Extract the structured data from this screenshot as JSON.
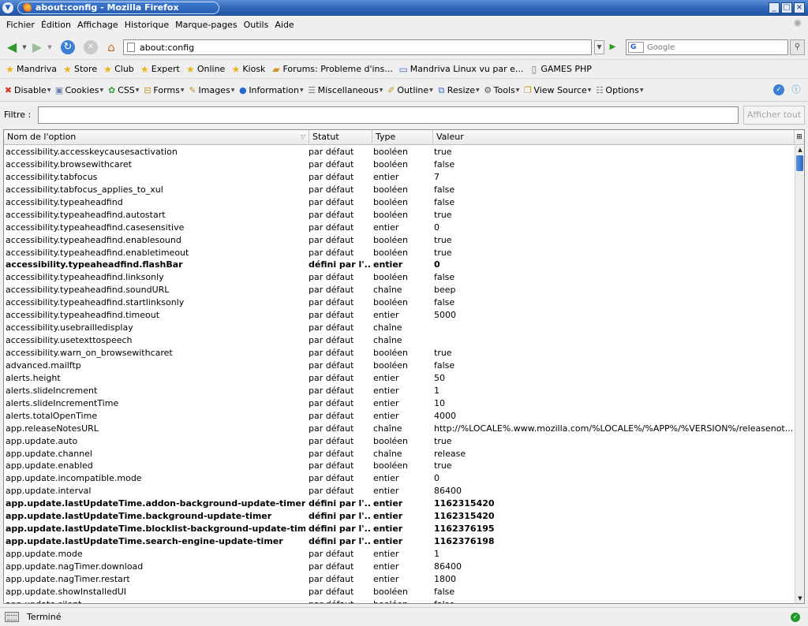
{
  "window": {
    "title": "about:config - Mozilla Firefox"
  },
  "menu": [
    "Fichier",
    "Édition",
    "Affichage",
    "Historique",
    "Marque-pages",
    "Outils",
    "Aide"
  ],
  "navigation": {
    "url": "about:config",
    "search_placeholder": "Google",
    "search_engine": "G"
  },
  "bookmarks": [
    {
      "label": "Mandriva",
      "icon": "star-icon"
    },
    {
      "label": "Store",
      "icon": "star-icon"
    },
    {
      "label": "Club",
      "icon": "star-icon"
    },
    {
      "label": "Expert",
      "icon": "star-icon"
    },
    {
      "label": "Online",
      "icon": "star-icon"
    },
    {
      "label": "Kiosk",
      "icon": "star-icon"
    },
    {
      "label": "Forums: Probleme d'ins...",
      "icon": "folder-icon"
    },
    {
      "label": "Mandriva Linux vu par e...",
      "icon": "screen-icon"
    },
    {
      "label": "GAMES PHP",
      "icon": "page-icon"
    }
  ],
  "developer_toolbar": [
    {
      "label": "Disable",
      "icon": "disable-icon"
    },
    {
      "label": "Cookies",
      "icon": "cookies-icon"
    },
    {
      "label": "CSS",
      "icon": "css-icon"
    },
    {
      "label": "Forms",
      "icon": "forms-icon"
    },
    {
      "label": "Images",
      "icon": "images-icon"
    },
    {
      "label": "Information",
      "icon": "information-icon"
    },
    {
      "label": "Miscellaneous",
      "icon": "miscellaneous-icon"
    },
    {
      "label": "Outline",
      "icon": "outline-icon"
    },
    {
      "label": "Resize",
      "icon": "resize-icon"
    },
    {
      "label": "Tools",
      "icon": "tools-icon"
    },
    {
      "label": "View Source",
      "icon": "view-source-icon"
    },
    {
      "label": "Options",
      "icon": "options-icon"
    }
  ],
  "filter": {
    "label": "Filtre :",
    "value": "",
    "show_all_label": "Afficher tout"
  },
  "table": {
    "columns": [
      "Nom de l'option",
      "Statut",
      "Type",
      "Valeur"
    ],
    "rows": [
      {
        "name": "accessibility.accesskeycausesactivation",
        "status": "par défaut",
        "type": "booléen",
        "value": "true",
        "bold": false
      },
      {
        "name": "accessibility.browsewithcaret",
        "status": "par défaut",
        "type": "booléen",
        "value": "false",
        "bold": false
      },
      {
        "name": "accessibility.tabfocus",
        "status": "par défaut",
        "type": "entier",
        "value": "7",
        "bold": false
      },
      {
        "name": "accessibility.tabfocus_applies_to_xul",
        "status": "par défaut",
        "type": "booléen",
        "value": "false",
        "bold": false
      },
      {
        "name": "accessibility.typeaheadfind",
        "status": "par défaut",
        "type": "booléen",
        "value": "false",
        "bold": false
      },
      {
        "name": "accessibility.typeaheadfind.autostart",
        "status": "par défaut",
        "type": "booléen",
        "value": "true",
        "bold": false
      },
      {
        "name": "accessibility.typeaheadfind.casesensitive",
        "status": "par défaut",
        "type": "entier",
        "value": "0",
        "bold": false
      },
      {
        "name": "accessibility.typeaheadfind.enablesound",
        "status": "par défaut",
        "type": "booléen",
        "value": "true",
        "bold": false
      },
      {
        "name": "accessibility.typeaheadfind.enabletimeout",
        "status": "par défaut",
        "type": "booléen",
        "value": "true",
        "bold": false
      },
      {
        "name": "accessibility.typeaheadfind.flashBar",
        "status": "défini par l'...",
        "type": "entier",
        "value": "0",
        "bold": true
      },
      {
        "name": "accessibility.typeaheadfind.linksonly",
        "status": "par défaut",
        "type": "booléen",
        "value": "false",
        "bold": false
      },
      {
        "name": "accessibility.typeaheadfind.soundURL",
        "status": "par défaut",
        "type": "chaîne",
        "value": "beep",
        "bold": false
      },
      {
        "name": "accessibility.typeaheadfind.startlinksonly",
        "status": "par défaut",
        "type": "booléen",
        "value": "false",
        "bold": false
      },
      {
        "name": "accessibility.typeaheadfind.timeout",
        "status": "par défaut",
        "type": "entier",
        "value": "5000",
        "bold": false
      },
      {
        "name": "accessibility.usebrailledisplay",
        "status": "par défaut",
        "type": "chaîne",
        "value": "",
        "bold": false
      },
      {
        "name": "accessibility.usetexttospeech",
        "status": "par défaut",
        "type": "chaîne",
        "value": "",
        "bold": false
      },
      {
        "name": "accessibility.warn_on_browsewithcaret",
        "status": "par défaut",
        "type": "booléen",
        "value": "true",
        "bold": false
      },
      {
        "name": "advanced.mailftp",
        "status": "par défaut",
        "type": "booléen",
        "value": "false",
        "bold": false
      },
      {
        "name": "alerts.height",
        "status": "par défaut",
        "type": "entier",
        "value": "50",
        "bold": false
      },
      {
        "name": "alerts.slideIncrement",
        "status": "par défaut",
        "type": "entier",
        "value": "1",
        "bold": false
      },
      {
        "name": "alerts.slideIncrementTime",
        "status": "par défaut",
        "type": "entier",
        "value": "10",
        "bold": false
      },
      {
        "name": "alerts.totalOpenTime",
        "status": "par défaut",
        "type": "entier",
        "value": "4000",
        "bold": false
      },
      {
        "name": "app.releaseNotesURL",
        "status": "par défaut",
        "type": "chaîne",
        "value": "http://%LOCALE%.www.mozilla.com/%LOCALE%/%APP%/%VERSION%/releasenot...",
        "bold": false
      },
      {
        "name": "app.update.auto",
        "status": "par défaut",
        "type": "booléen",
        "value": "true",
        "bold": false
      },
      {
        "name": "app.update.channel",
        "status": "par défaut",
        "type": "chaîne",
        "value": "release",
        "bold": false
      },
      {
        "name": "app.update.enabled",
        "status": "par défaut",
        "type": "booléen",
        "value": "true",
        "bold": false
      },
      {
        "name": "app.update.incompatible.mode",
        "status": "par défaut",
        "type": "entier",
        "value": "0",
        "bold": false
      },
      {
        "name": "app.update.interval",
        "status": "par défaut",
        "type": "entier",
        "value": "86400",
        "bold": false
      },
      {
        "name": "app.update.lastUpdateTime.addon-background-update-timer",
        "status": "défini par l'...",
        "type": "entier",
        "value": "1162315420",
        "bold": true
      },
      {
        "name": "app.update.lastUpdateTime.background-update-timer",
        "status": "défini par l'...",
        "type": "entier",
        "value": "1162315420",
        "bold": true
      },
      {
        "name": "app.update.lastUpdateTime.blocklist-background-update-timer",
        "status": "défini par l'...",
        "type": "entier",
        "value": "1162376195",
        "bold": true
      },
      {
        "name": "app.update.lastUpdateTime.search-engine-update-timer",
        "status": "défini par l'...",
        "type": "entier",
        "value": "1162376198",
        "bold": true
      },
      {
        "name": "app.update.mode",
        "status": "par défaut",
        "type": "entier",
        "value": "1",
        "bold": false
      },
      {
        "name": "app.update.nagTimer.download",
        "status": "par défaut",
        "type": "entier",
        "value": "86400",
        "bold": false
      },
      {
        "name": "app.update.nagTimer.restart",
        "status": "par défaut",
        "type": "entier",
        "value": "1800",
        "bold": false
      },
      {
        "name": "app.update.showInstalledUI",
        "status": "par défaut",
        "type": "booléen",
        "value": "false",
        "bold": false
      },
      {
        "name": "app.update.silent",
        "status": "par défaut",
        "type": "booléen",
        "value": "false",
        "bold": false
      }
    ]
  },
  "status": {
    "text": "Terminé"
  }
}
